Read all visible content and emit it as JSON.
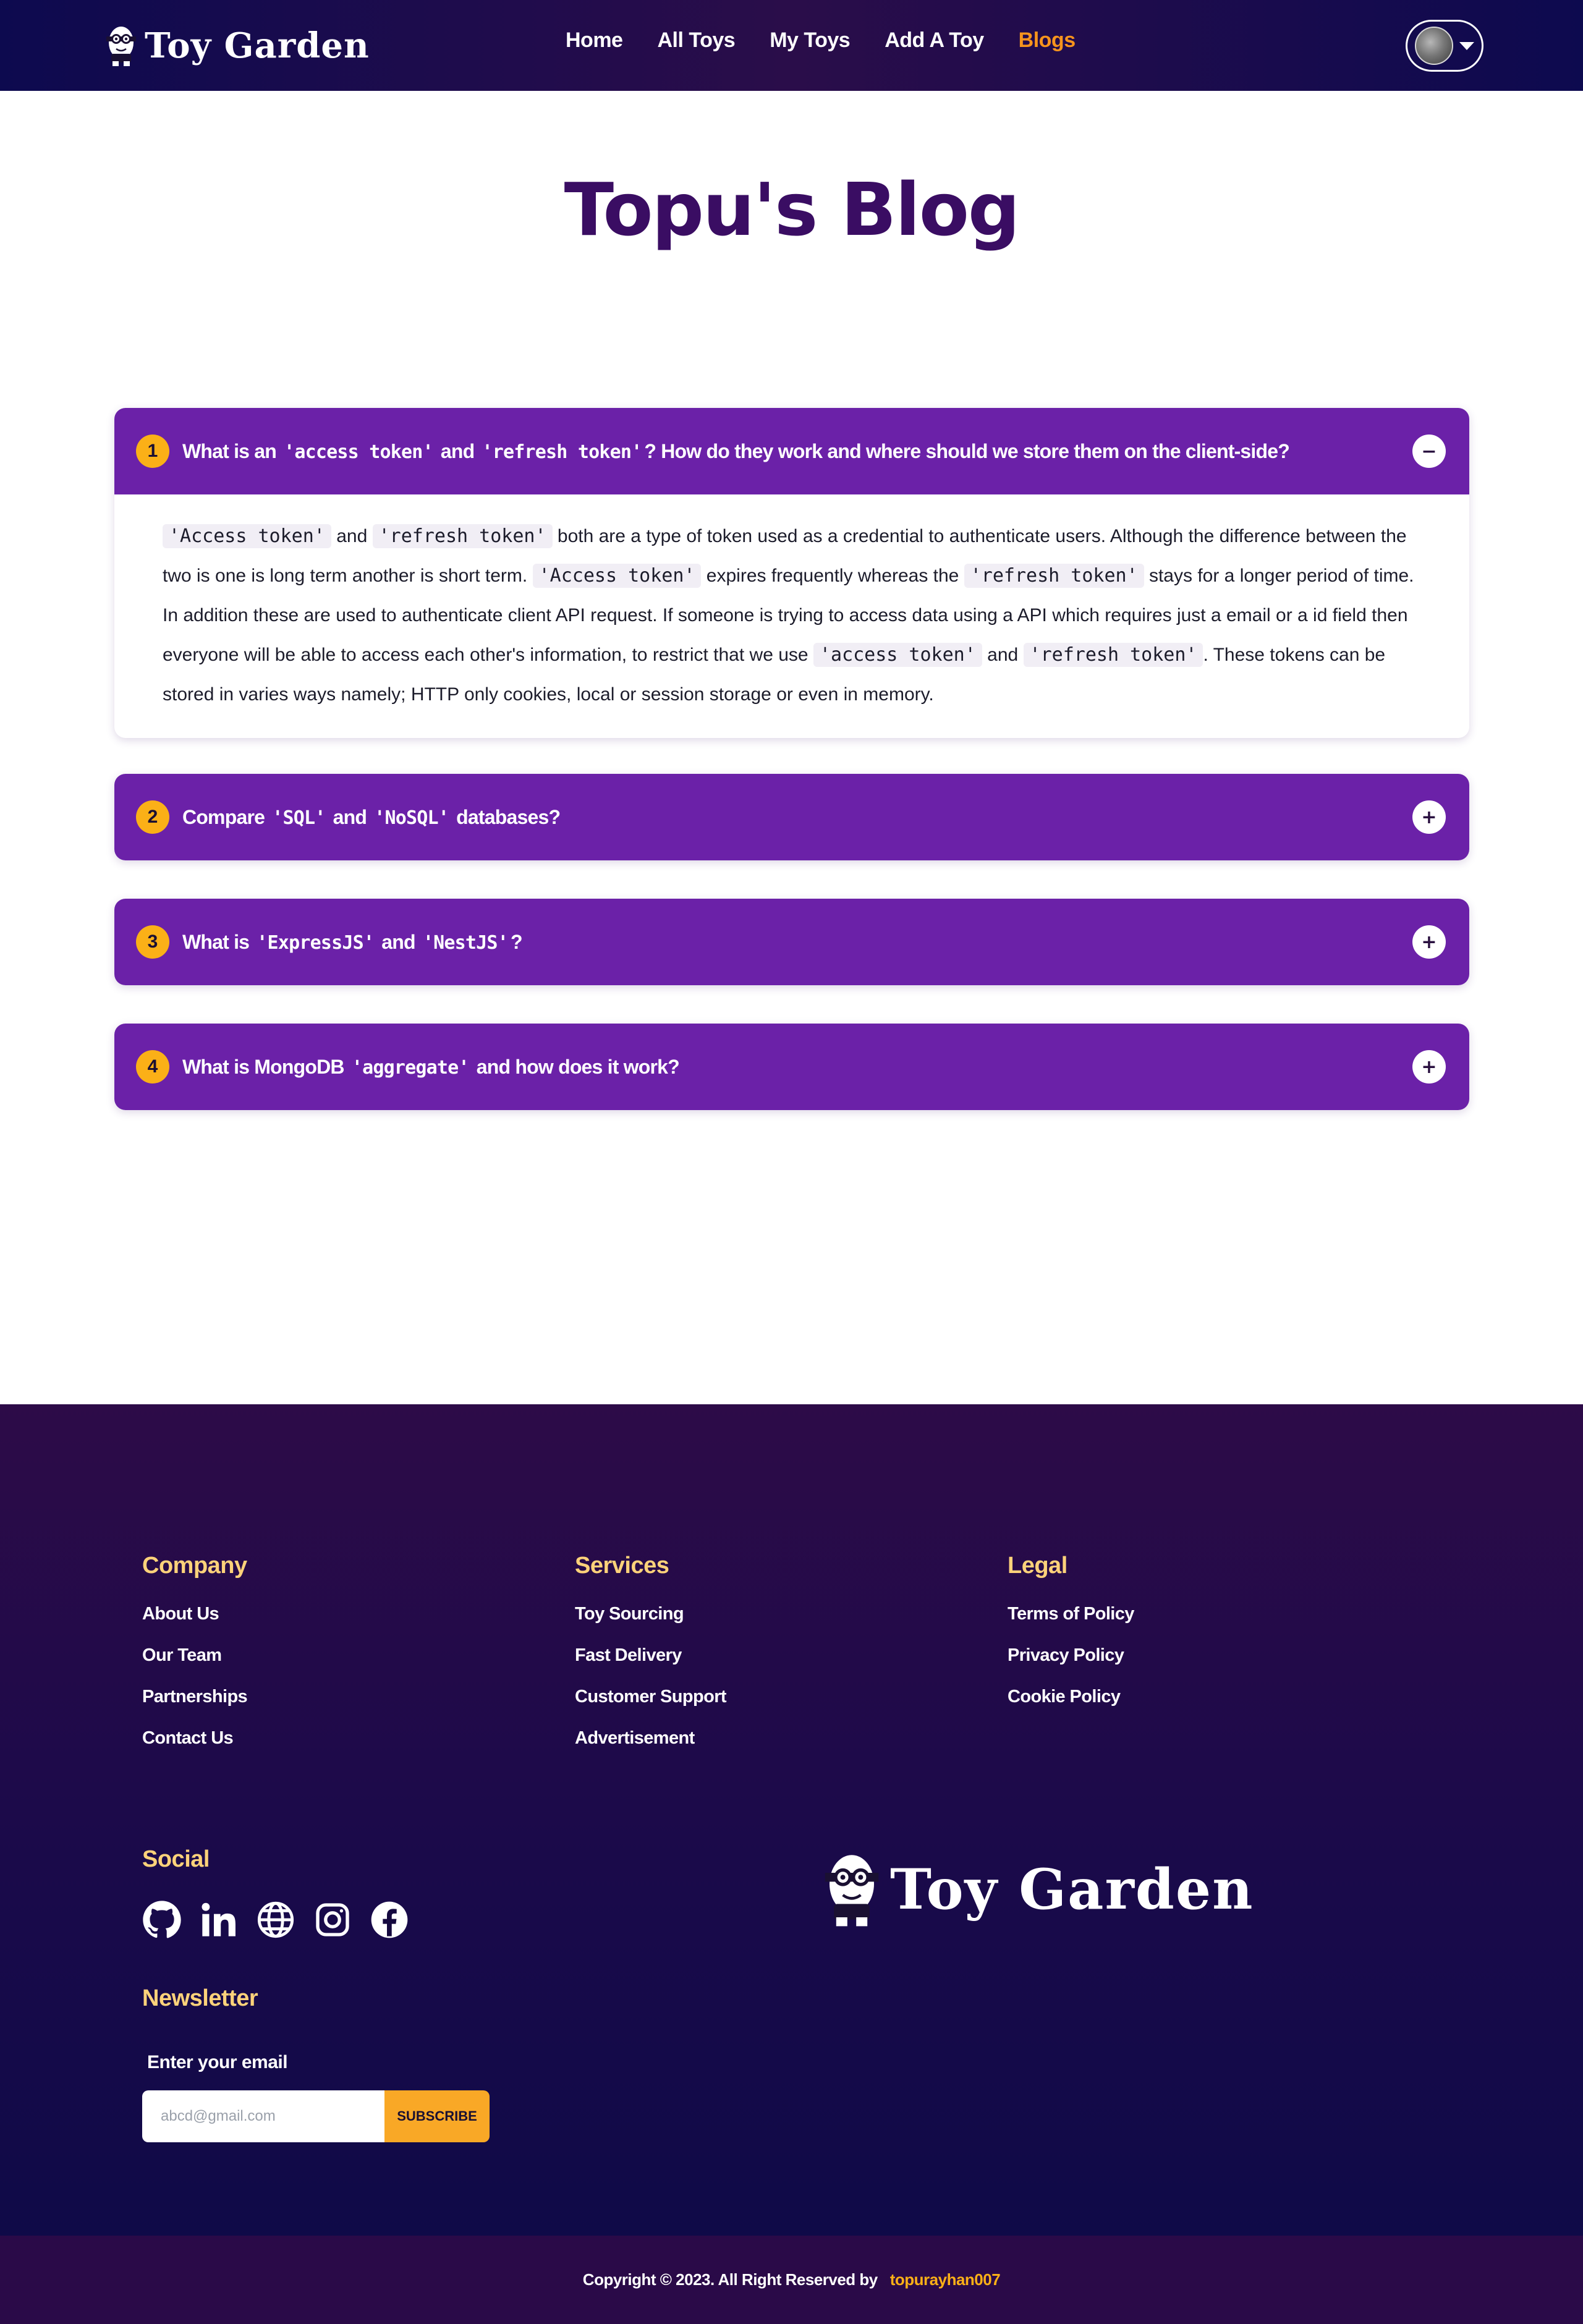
{
  "nav": {
    "brand": "Toy Garden",
    "links": [
      "Home",
      "All Toys",
      "My Toys",
      "Add A Toy",
      "Blogs"
    ],
    "active_link": "Blogs"
  },
  "page": {
    "title": "Topu's Blog"
  },
  "faq": [
    {
      "num": "1",
      "q_parts": [
        "What is an ",
        "'access token'",
        " and ",
        "'refresh token'",
        "? How do they work and where should we store them on the client-side?"
      ],
      "toggle": "−",
      "answer_parts": [
        "'Access token'",
        " and ",
        "'refresh token'",
        " both are a type of token used as a credential to authenticate users. Although the difference between the two is one is long term another is short term. ",
        "'Access token'",
        " expires frequently whereas the ",
        "'refresh token'",
        " stays for a longer period of time. In addition these are used to authenticate client API request. If someone is trying to access data using a API which requires just a email or a id field then everyone will be able to access each other's information, to restrict that we use ",
        "'access token'",
        " and ",
        "'refresh token'",
        ". These tokens can be stored in varies ways namely; HTTP only cookies, local or session storage or even in memory."
      ]
    },
    {
      "num": "2",
      "q_parts": [
        "Compare ",
        "'SQL'",
        " and ",
        "'NoSQL'",
        " databases?"
      ],
      "toggle": "+"
    },
    {
      "num": "3",
      "q_parts": [
        "What is ",
        "'ExpressJS'",
        " and ",
        "'NestJS'",
        "?"
      ],
      "toggle": "+"
    },
    {
      "num": "4",
      "q_parts": [
        "What is MongoDB ",
        "'aggregate'",
        " and how does it work?"
      ],
      "toggle": "+"
    }
  ],
  "footer": {
    "company": {
      "title": "Company",
      "links": [
        "About Us",
        "Our Team",
        "Partnerships",
        "Contact Us"
      ]
    },
    "services": {
      "title": "Services",
      "links": [
        "Toy Sourcing",
        "Fast Delivery",
        "Customer Support",
        "Advertisement"
      ]
    },
    "legal": {
      "title": "Legal",
      "links": [
        "Terms of Policy",
        "Privacy Policy",
        "Cookie Policy"
      ]
    },
    "social": {
      "title": "Social",
      "icons": [
        "github-icon",
        "linkedin-icon",
        "globe-icon",
        "instagram-icon",
        "facebook-icon"
      ]
    },
    "newsletter": {
      "title": "Newsletter",
      "label": "Enter your email",
      "placeholder": "abcd@gmail.com",
      "button": "SUBSCRIBE"
    },
    "brand": "Toy Garden",
    "copyright": {
      "text": "Copyright  ©  2023. All Right Reserved by",
      "author": "topurayhan007"
    }
  },
  "colors": {
    "nav_bg": "#0d0a4f",
    "accent": "#f7941d",
    "accordion": "#6b21a8",
    "badge": "#fbb017",
    "title": "#3a0d63"
  }
}
